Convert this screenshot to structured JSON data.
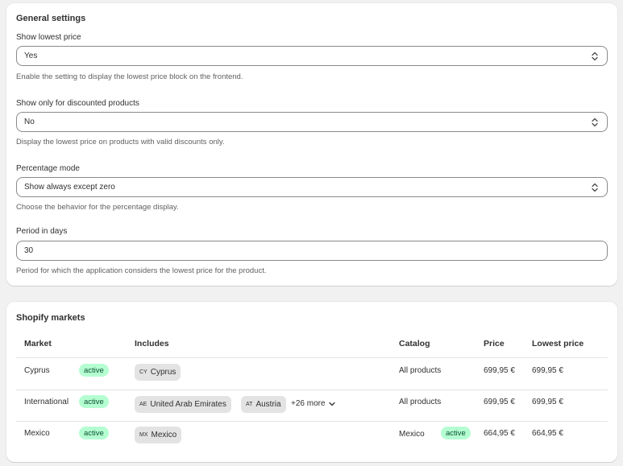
{
  "general": {
    "title": "General settings",
    "fields": [
      {
        "label": "Show lowest price",
        "value": "Yes",
        "help": "Enable the setting to display the lowest price block on the frontend."
      },
      {
        "label": "Show only for discounted products",
        "value": "No",
        "help": "Display the lowest price on products with valid discounts only."
      },
      {
        "label": "Percentage mode",
        "value": "Show always except zero",
        "help": "Choose the behavior for the percentage display."
      },
      {
        "label": "Period in days",
        "value": "30",
        "help": "Period for which the application considers the lowest price for the product."
      }
    ]
  },
  "markets": {
    "title": "Shopify markets",
    "headers": {
      "market": "Market",
      "includes": "Includes",
      "catalog": "Catalog",
      "price": "Price",
      "lowest_price": "Lowest price"
    },
    "rows": [
      {
        "market": "Cyprus",
        "status": "active",
        "includes": [
          {
            "code": "CY",
            "name": "Cyprus"
          }
        ],
        "more": "",
        "catalog": "All products",
        "catalog_status": "",
        "price": "699,95 €",
        "lowest_price": "699,95 €"
      },
      {
        "market": "International",
        "status": "active",
        "includes": [
          {
            "code": "AE",
            "name": "United Arab Emirates"
          },
          {
            "code": "AT",
            "name": "Austria"
          }
        ],
        "more": "+26 more",
        "catalog": "All products",
        "catalog_status": "",
        "price": "699,95 €",
        "lowest_price": "699,95 €"
      },
      {
        "market": "Mexico",
        "status": "active",
        "includes": [
          {
            "code": "MX",
            "name": "Mexico"
          }
        ],
        "more": "",
        "catalog": "Mexico",
        "catalog_status": "active",
        "price": "664,95 €",
        "lowest_price": "664,95 €"
      }
    ]
  },
  "colors": {
    "badge_bg": "#b4fed2",
    "badge_text": "#0c5132",
    "tag_bg": "#e3e3e3",
    "page_bg": "#f1f1f1"
  },
  "icons": {
    "select": "select-chevron-icon",
    "more": "chevron-down-icon"
  }
}
